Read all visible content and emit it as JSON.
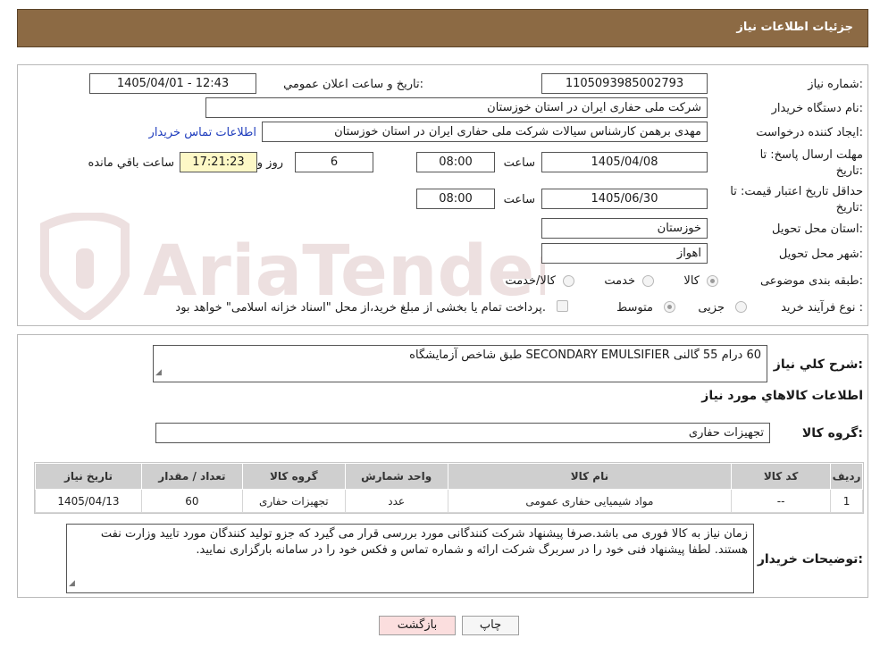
{
  "header": {
    "title": "جزئیات اطلاعات نیاز"
  },
  "fields": {
    "need_number_label": "شماره نیاز:",
    "need_number": "1105093985002793",
    "announce_label": "تاریخ و ساعت اعلان عمومي:",
    "announce_value": "1405/04/01 - 12:43",
    "buyer_org_label": "نام دستگاه خریدار:",
    "buyer_org": "شرکت ملی حفاری ایران در استان خوزستان",
    "requester_label": "ایجاد کننده درخواست:",
    "requester": "مهدی برهمن کارشناس سیالات شرکت ملی حفاری ایران در استان خوزستان",
    "contact_link": "اطلاعات تماس خریدار",
    "deadline_label_1": "مهلت ارسال پاسخ: تا",
    "deadline_label_2": "تاریخ:",
    "deadline_date": "1405/04/08",
    "time_label": "ساعت",
    "deadline_time": "08:00",
    "days_value": "6",
    "days_label": "روز و",
    "remaining_time": "17:21:23",
    "remaining_label": "ساعت باقي مانده",
    "validity_label_1": "حداقل تاریخ اعتبار قیمت: تا",
    "validity_label_2": "تاریخ:",
    "validity_date": "1405/06/30",
    "validity_time": "08:00",
    "province_label": "استان محل تحویل:",
    "province": "خوزستان",
    "city_label": "شهر محل تحویل:",
    "city": "اهواز",
    "category_label": "طبقه بندی موضوعی:",
    "category_options": [
      "کالا",
      "خدمت",
      "کالا/خدمت"
    ],
    "purchase_type_label": "نوع فرآیند خرید :",
    "purchase_options": [
      "جزیی",
      "متوسط"
    ],
    "treasury_note": "پرداخت تمام یا بخشی از مبلغ خرید،از محل \"اسناد خزانه اسلامی\" خواهد بود."
  },
  "summary": {
    "label": "شرح کلي نیاز:",
    "value": "60 درام 55 گالنی SECONDARY EMULSIFIER طبق شاخص آزمایشگاه"
  },
  "goods_info_title": "اطلاعات کالاهاي مورد نیاز",
  "goods_group": {
    "label": "گروه کالا:",
    "value": "تجهیزات حفاری"
  },
  "table": {
    "headers": [
      "ردیف",
      "کد کالا",
      "نام کالا",
      "واحد شمارش",
      "گروه کالا",
      "تعداد / مقدار",
      "تاریخ نیاز"
    ],
    "rows": [
      [
        "1",
        "--",
        "مواد شیمیایی حفاری عمومی",
        "عدد",
        "تجهیزات حفاری",
        "60",
        "1405/04/13"
      ]
    ]
  },
  "buyer_notes": {
    "label": "توضیحات خریدار:",
    "text": "زمان نیاز به کالا فوری می باشد.صرفا پیشنهاد شرکت کنندگانی مورد بررسی قرار می گیرد که جزو تولید کنندگان  مورد تایید وزارت نفت هستند. لطفا پیشنهاد فنی خود را در سربرگ شرکت ارائه و شماره تماس و فکس خود را در سامانه بارگزاری نمایید."
  },
  "buttons": {
    "print": "چاپ",
    "back": "بازگشت"
  },
  "watermark": "AriaTender.neT",
  "colors": {
    "header_bg": "#8c6a44",
    "link": "#1f3dbd",
    "back_button": "#fbdede",
    "remaining_time_bg": "#fdf8c6"
  }
}
